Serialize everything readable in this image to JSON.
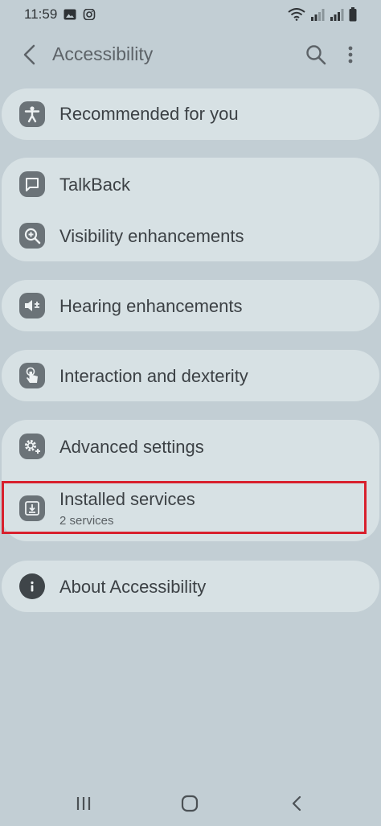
{
  "status_bar": {
    "time": "11:59"
  },
  "app_bar": {
    "title": "Accessibility"
  },
  "items": {
    "recommended": {
      "label": "Recommended for you"
    },
    "talkback": {
      "label": "TalkBack"
    },
    "visibility": {
      "label": "Visibility enhancements"
    },
    "hearing": {
      "label": "Hearing enhancements"
    },
    "interaction": {
      "label": "Interaction and dexterity"
    },
    "advanced": {
      "label": "Advanced settings"
    },
    "installed": {
      "label": "Installed services",
      "sub": "2 services"
    },
    "about": {
      "label": "About Accessibility"
    }
  },
  "colors": {
    "background": "#c2ced4",
    "card": "#d7e1e4",
    "icon_bg": "#6b7378",
    "highlight": "#d8202d"
  }
}
